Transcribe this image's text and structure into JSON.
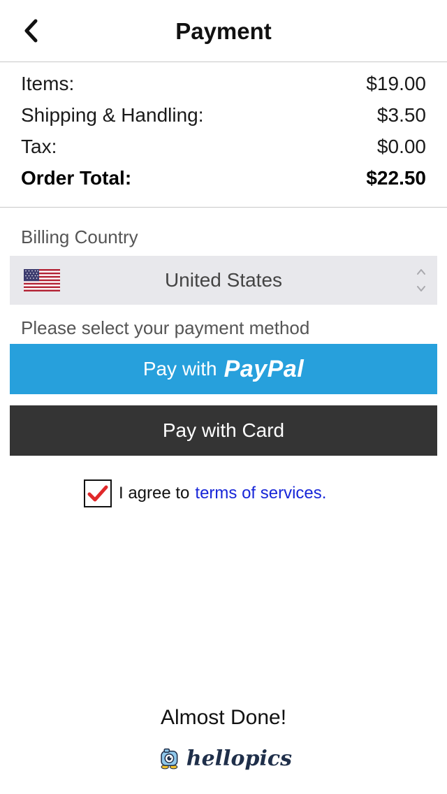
{
  "header": {
    "title": "Payment",
    "back_icon": "chevron-left-icon"
  },
  "summary": {
    "items_label": "Items:",
    "items_value": "$19.00",
    "shipping_label": "Shipping & Handling:",
    "shipping_value": "$3.50",
    "tax_label": "Tax:",
    "tax_value": "$0.00",
    "total_label": "Order Total:",
    "total_value": "$22.50"
  },
  "billing": {
    "label": "Billing Country",
    "selected_country": "United States",
    "flag_icon": "us-flag-icon"
  },
  "payment": {
    "prompt": "Please select your payment method",
    "paypal_prefix": "Pay with",
    "paypal_brand": "PayPal",
    "paypal_color": "#27a0dc",
    "card_label": "Pay with Card",
    "card_color": "#343434"
  },
  "agreement": {
    "checked": true,
    "text": "I agree to",
    "link_text": "terms of services.",
    "link_color": "#1726d8",
    "check_color": "#e0282a"
  },
  "footer": {
    "message": "Almost Done!",
    "brand": "hellopics"
  }
}
